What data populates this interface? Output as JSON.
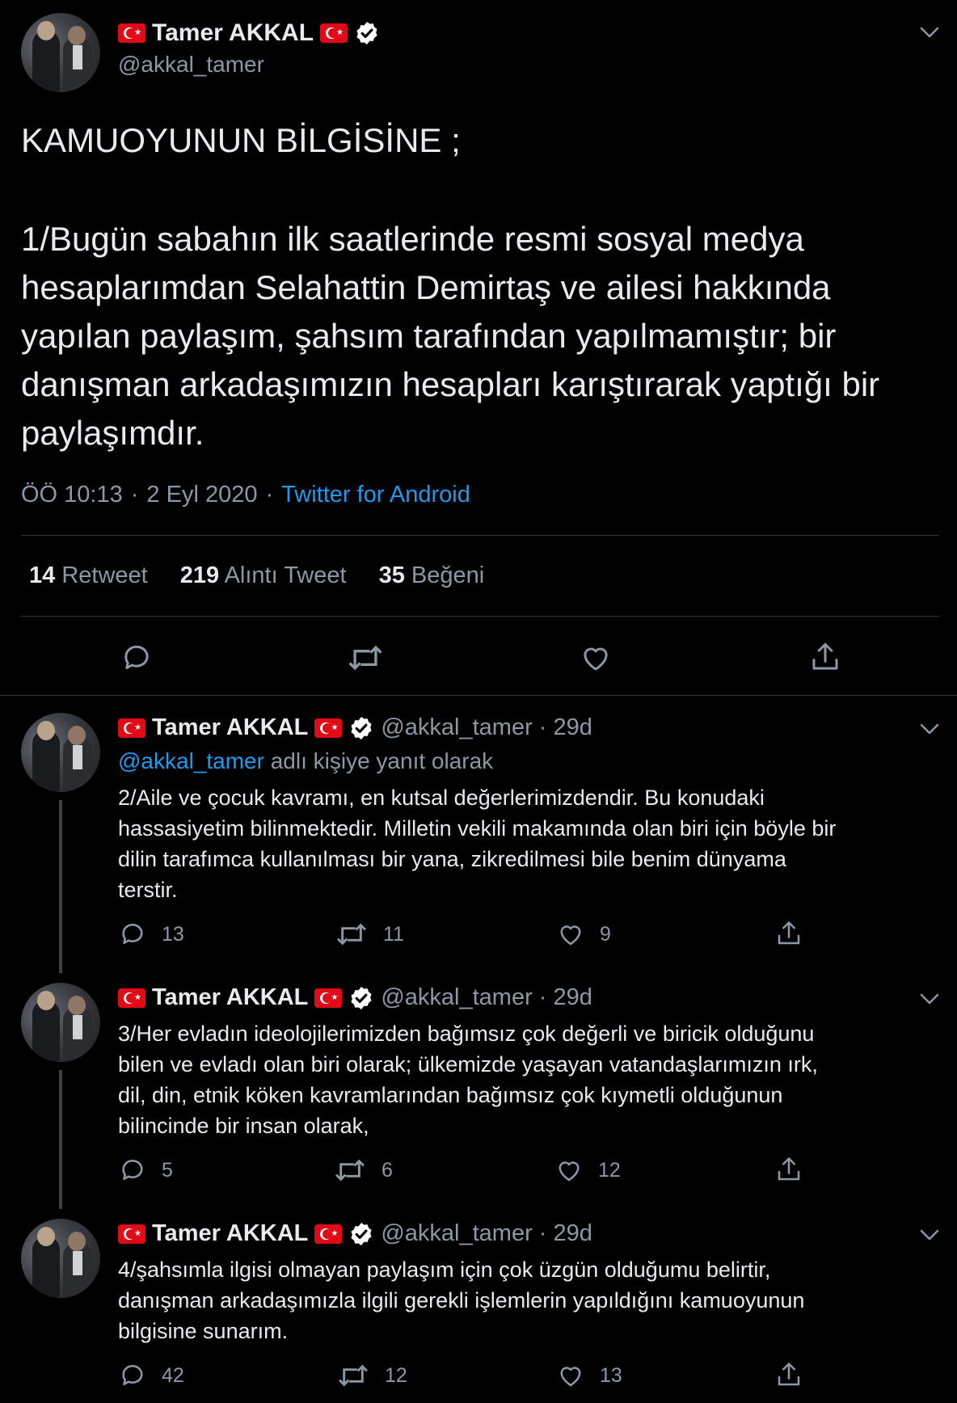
{
  "main_tweet": {
    "author_name": "Tamer AKKAL",
    "handle": "@akkal_tamer",
    "heading": "KAMUOYUNUN BİLGİSİNE ;",
    "body_lines": [
      "1/Bugün sabahın ilk saatlerinde resmi sosyal medya",
      "hesaplarımdan Selahattin Demirtaş ve ailesi hakkında",
      "yapılan paylaşım, şahsım tarafından yapılmamıştır; bir",
      "danışman arkadaşımızın hesapları karıştırarak yaptığı bir",
      "paylaşımdır."
    ],
    "time": "ÖÖ 10:13",
    "date": "2 Eyl 2020",
    "dot": "·",
    "source": "Twitter for Android",
    "stats": {
      "retweets": "14",
      "retweets_label": "Retweet",
      "quotes": "219",
      "quotes_label": "Alıntı Tweet",
      "likes": "35",
      "likes_label": "Beğeni"
    }
  },
  "replies": [
    {
      "author_name": "Tamer AKKAL",
      "handle": "@akkal_tamer",
      "age": "29d",
      "reply_to_handle": "@akkal_tamer",
      "reply_to_suffix": "adlı kişiye yanıt olarak",
      "lines": [
        "2/Aile ve çocuk kavramı, en kutsal değerlerimizdendir. Bu konudaki",
        "hassasiyetim bilinmektedir. Milletin vekili makamında olan biri için böyle bir",
        "dilin tarafımca kullanılması bir yana, zikredilmesi bile benim dünyama",
        "terstir."
      ],
      "replies": "13",
      "retweets": "11",
      "likes": "9"
    },
    {
      "author_name": "Tamer AKKAL",
      "handle": "@akkal_tamer",
      "age": "29d",
      "lines": [
        "3/Her evladın ideolojilerimizden bağımsız çok değerli ve biricik olduğunu",
        "bilen ve evladı olan biri olarak; ülkemizde yaşayan vatandaşlarımızın ırk,",
        "dil, din, etnik köken kavramlarından bağımsız çok kıymetli olduğunun",
        "bilincinde bir insan olarak,"
      ],
      "replies": "5",
      "retweets": "6",
      "likes": "12"
    },
    {
      "author_name": "Tamer AKKAL",
      "handle": "@akkal_tamer",
      "age": "29d",
      "lines": [
        "4/şahsımla ilgisi olmayan paylaşım için çok üzgün olduğumu belirtir,",
        "danışman arkadaşımızla ilgili gerekli işlemlerin yapıldığını kamuoyunun",
        "bilgisine sunarım."
      ],
      "replies": "42",
      "retweets": "12",
      "likes": "13"
    }
  ],
  "colors": {
    "background": "#000000",
    "text": "#e8eaed",
    "muted": "#8b98a5",
    "link": "#1d9bf0",
    "flag": "#e30a17"
  },
  "icons": [
    "chevron-down-icon",
    "turkey-flag-icon",
    "verified-badge-icon",
    "reply-icon",
    "retweet-icon",
    "like-icon",
    "share-icon"
  ]
}
